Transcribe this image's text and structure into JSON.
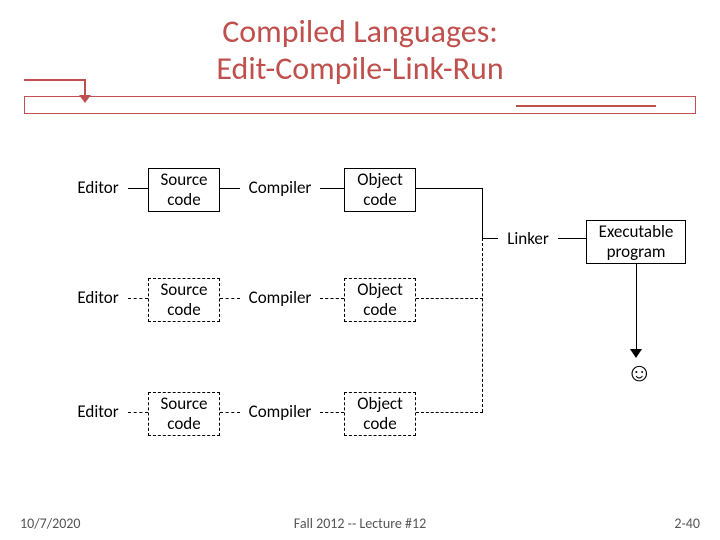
{
  "title_line1": "Compiled Languages:",
  "title_line2": "Edit-Compile-Link-Run",
  "rows": [
    {
      "editor": "Editor",
      "source": "Source\ncode",
      "compiler": "Compiler",
      "object": "Object\ncode"
    },
    {
      "editor": "Editor",
      "source": "Source\ncode",
      "compiler": "Compiler",
      "object": "Object\ncode"
    },
    {
      "editor": "Editor",
      "source": "Source\ncode",
      "compiler": "Compiler",
      "object": "Object\ncode"
    }
  ],
  "linker": "Linker",
  "executable": "Executable\nprogram",
  "smiley": "☺",
  "footer": {
    "date": "10/7/2020",
    "center": "Fall 2012 -- Lecture #12",
    "page": "2-40"
  }
}
